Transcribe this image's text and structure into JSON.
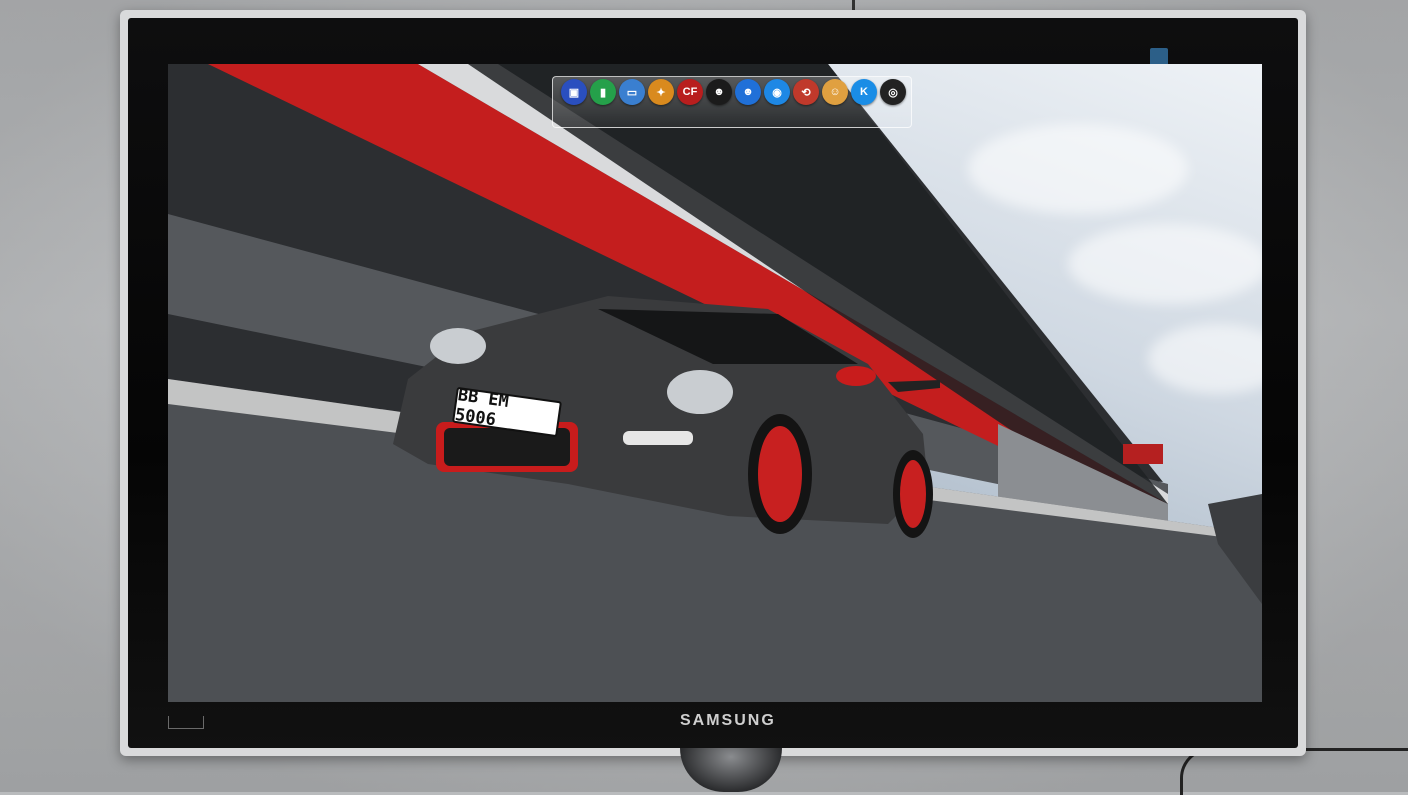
{
  "monitor": {
    "brand": "SAMSUNG"
  },
  "wallpaper": {
    "subject": "",
    "license_plate": "BB EM 5006"
  },
  "dock": {
    "icons": [
      {
        "name": "monitor-icon",
        "color": "#2a4fbf",
        "glyph": "▣"
      },
      {
        "name": "recycle-bin-icon",
        "color": "#25a04a",
        "glyph": "▮"
      },
      {
        "name": "tv-icon",
        "color": "#3a7fd0",
        "glyph": "▭"
      },
      {
        "name": "cat-icon",
        "color": "#d98a1e",
        "glyph": "✦"
      },
      {
        "name": "crossfire-icon",
        "color": "#b81e1e",
        "glyph": "CF"
      },
      {
        "name": "qq-penguin-icon",
        "color": "#1b1b1b",
        "glyph": "☻"
      },
      {
        "name": "qq-penguin-blue-icon",
        "color": "#2070d8",
        "glyph": "☻"
      },
      {
        "name": "browser-icon",
        "color": "#1e88e5",
        "glyph": "◉"
      },
      {
        "name": "chrome-icon",
        "color": "#c0392b",
        "glyph": "⟲"
      },
      {
        "name": "avatar-icon",
        "color": "#e0a040",
        "glyph": "☺"
      },
      {
        "name": "kugou-icon",
        "color": "#1a8de6",
        "glyph": "K"
      },
      {
        "name": "disc-icon",
        "color": "#222222",
        "glyph": "◎"
      }
    ]
  }
}
